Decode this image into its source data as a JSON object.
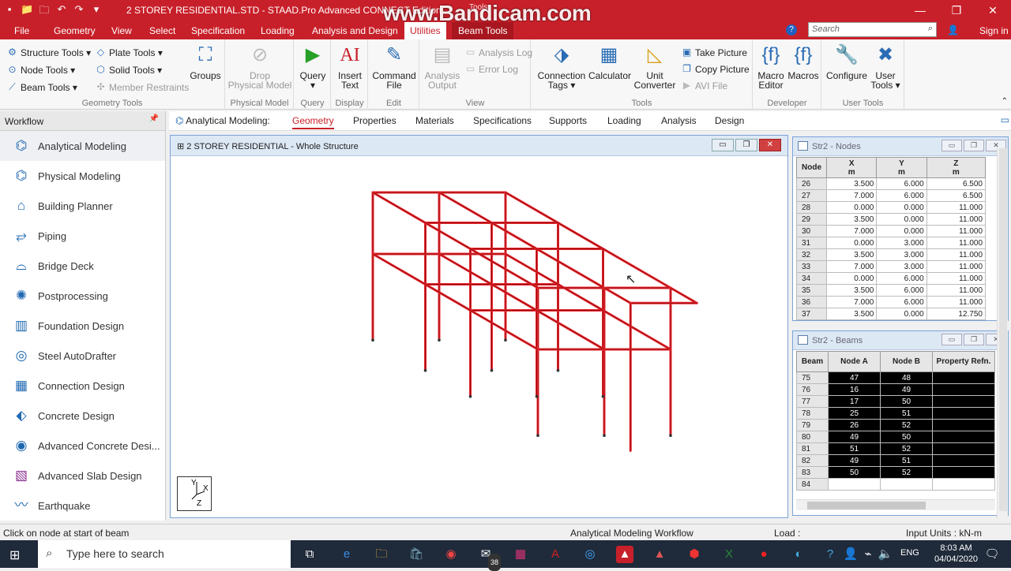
{
  "titlebar": {
    "title": "2 STOREY RESIDENTIAL.STD - STAAD.Pro Advanced CONNECT Edition",
    "context": "Tools",
    "watermark": "www.Bandicam.com"
  },
  "menu": {
    "items": [
      "File",
      "Geometry",
      "View",
      "Select",
      "Specification",
      "Loading",
      "Analysis and Design",
      "Utilities",
      "Beam Tools"
    ],
    "search_placeholder": "Search",
    "sign_in": "Sign in"
  },
  "ribbon": {
    "geometry_tools": {
      "label": "Geometry Tools",
      "structure_tools": "Structure Tools ▾",
      "node_tools": "Node Tools ▾",
      "beam_tools": "Beam Tools ▾",
      "plate_tools": "Plate Tools ▾",
      "solid_tools": "Solid Tools ▾",
      "member_restraints": "Member Restraints",
      "groups": "Groups"
    },
    "physical_model": {
      "label": "Physical Model",
      "drop_line1": "Drop",
      "drop_line2": "Physical Model"
    },
    "query": {
      "label": "Query",
      "button": "Query",
      "arrow": "▾"
    },
    "display": {
      "label": "Display",
      "insert_line1": "Insert",
      "insert_line2": "Text"
    },
    "edit": {
      "label": "Edit",
      "command_line1": "Command",
      "command_line2": "File"
    },
    "view": {
      "label": "View",
      "analysis_line1": "Analysis",
      "analysis_line2": "Output",
      "analysis_log": "Analysis Log",
      "error_log": "Error Log"
    },
    "tools": {
      "label": "Tools",
      "connection_line1": "Connection",
      "connection_line2": "Tags ▾",
      "calculator": "Calculator",
      "unit_line1": "Unit",
      "unit_line2": "Converter",
      "take_picture": "Take Picture",
      "copy_picture": "Copy Picture",
      "avi_file": "AVI File"
    },
    "developer": {
      "label": "Developer",
      "macro_line1": "Macro",
      "macro_line2": "Editor",
      "macros": "Macros"
    },
    "user_tools": {
      "label": "User Tools",
      "configure": "Configure",
      "user_line1": "User",
      "user_line2": "Tools ▾"
    }
  },
  "workflow": {
    "header": "Workflow",
    "items": [
      "Analytical Modeling",
      "Physical Modeling",
      "Building Planner",
      "Piping",
      "Bridge Deck",
      "Postprocessing",
      "Foundation Design",
      "Steel AutoDrafter",
      "Connection Design",
      "Concrete Design",
      "Advanced Concrete Desi...",
      "Advanced Slab Design",
      "Earthquake"
    ]
  },
  "page_tabs": {
    "prefix": "Analytical Modeling:",
    "items": [
      "Geometry",
      "Properties",
      "Materials",
      "Specifications",
      "Supports",
      "Loading",
      "Analysis",
      "Design"
    ]
  },
  "view_window": {
    "title": "2 STOREY RESIDENTIAL - Whole Structure"
  },
  "nodes_panel": {
    "title": "Str2 - Nodes",
    "headers": [
      "Node",
      "X",
      "Y",
      "Z"
    ],
    "unit": "m",
    "rows": [
      [
        "26",
        "3.500",
        "6.000",
        "6.500"
      ],
      [
        "27",
        "7.000",
        "6.000",
        "6.500"
      ],
      [
        "28",
        "0.000",
        "0.000",
        "11.000"
      ],
      [
        "29",
        "3.500",
        "0.000",
        "11.000"
      ],
      [
        "30",
        "7.000",
        "0.000",
        "11.000"
      ],
      [
        "31",
        "0.000",
        "3.000",
        "11.000"
      ],
      [
        "32",
        "3.500",
        "3.000",
        "11.000"
      ],
      [
        "33",
        "7.000",
        "3.000",
        "11.000"
      ],
      [
        "34",
        "0.000",
        "6.000",
        "11.000"
      ],
      [
        "35",
        "3.500",
        "6.000",
        "11.000"
      ],
      [
        "36",
        "7.000",
        "6.000",
        "11.000"
      ],
      [
        "37",
        "3.500",
        "0.000",
        "12.750"
      ]
    ]
  },
  "beams_panel": {
    "title": "Str2 - Beams",
    "headers": [
      "Beam",
      "Node A",
      "Node B",
      "Property Refn."
    ],
    "rows": [
      [
        "75",
        "47",
        "48",
        ""
      ],
      [
        "76",
        "16",
        "49",
        ""
      ],
      [
        "77",
        "17",
        "50",
        ""
      ],
      [
        "78",
        "25",
        "51",
        ""
      ],
      [
        "79",
        "26",
        "52",
        ""
      ],
      [
        "80",
        "49",
        "50",
        ""
      ],
      [
        "81",
        "51",
        "52",
        ""
      ],
      [
        "82",
        "49",
        "51",
        ""
      ],
      [
        "83",
        "50",
        "52",
        ""
      ],
      [
        "84",
        "",
        "",
        ""
      ]
    ]
  },
  "status": {
    "hint": "Click on node at start of beam",
    "workflow": "Analytical Modeling Workflow",
    "load": "Load :",
    "units": "Input Units : kN-m"
  },
  "taskbar": {
    "search_placeholder": "Type here to search",
    "language": "ENG",
    "time": "8:03 AM",
    "date": "04/04/2020",
    "mail_badge": "38"
  },
  "colors": {
    "accent": "#c8202a",
    "frame": "#e8262e"
  }
}
